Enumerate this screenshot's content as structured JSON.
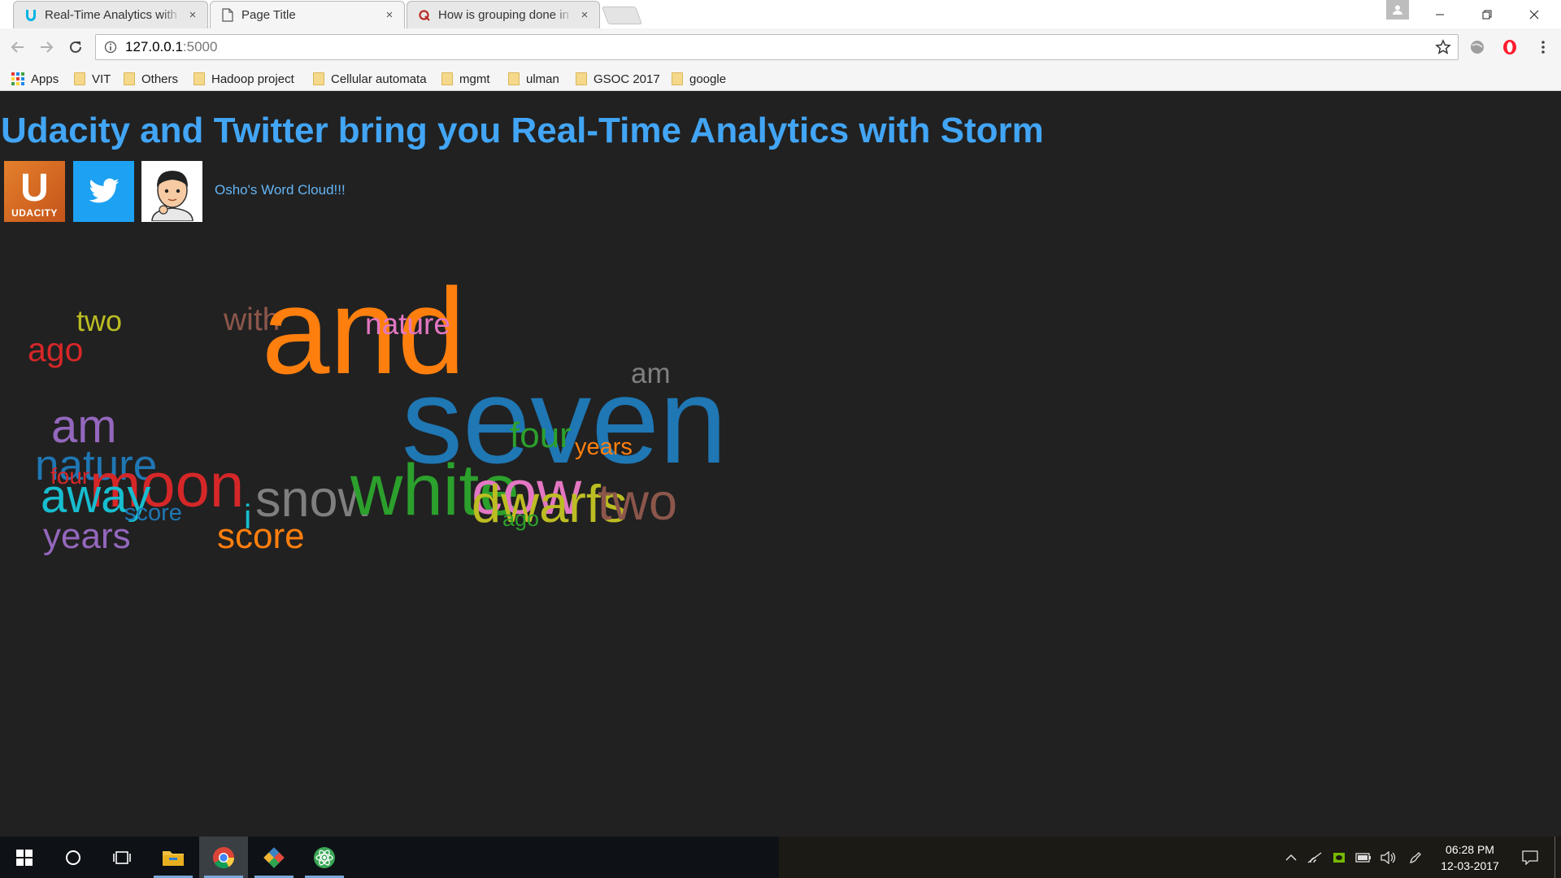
{
  "browser": {
    "tabs": [
      {
        "title": "Real-Time Analytics with",
        "icon": "udacity-icon"
      },
      {
        "title": "Page Title",
        "icon": "page-icon"
      },
      {
        "title": "How is grouping done in",
        "icon": "quora-icon"
      }
    ],
    "close_glyph": "×",
    "url_host": "127.0.0.1",
    "url_port": ":5000",
    "bookmarks": [
      {
        "label": "Apps",
        "icon": "apps-grid-icon"
      },
      {
        "label": "VIT",
        "icon": "folder-icon"
      },
      {
        "label": "Others",
        "icon": "folder-icon"
      },
      {
        "label": "Hadoop project",
        "icon": "folder-icon"
      },
      {
        "label": "Cellular automata",
        "icon": "folder-icon"
      },
      {
        "label": "mgmt",
        "icon": "folder-icon"
      },
      {
        "label": "ulman",
        "icon": "folder-icon"
      },
      {
        "label": "GSOC 2017",
        "icon": "folder-icon"
      },
      {
        "label": "google",
        "icon": "folder-icon"
      }
    ]
  },
  "page": {
    "title": "Udacity and Twitter bring you Real-Time Analytics with Storm",
    "logos": [
      {
        "name": "udacity-logo",
        "text": "U",
        "caption": "UDACITY"
      },
      {
        "name": "twitter-logo"
      },
      {
        "name": "avatar"
      }
    ],
    "cloud_link": "Osho's Word Cloud!!!",
    "word_cloud": {
      "colors": {
        "blue": "#1f77b4",
        "orange": "#ff7f0e",
        "green": "#2ca02c",
        "red": "#d62728",
        "purple": "#9467bd",
        "brown": "#8c564b",
        "pink": "#e377c2",
        "gray": "#7f7f7f",
        "olive": "#bcbd22",
        "cyan": "#17becf"
      },
      "words": [
        {
          "text": "two",
          "color": "olive"
        },
        {
          "text": "ago",
          "color": "red"
        },
        {
          "text": "with",
          "color": "brown"
        },
        {
          "text": "and",
          "color": "orange"
        },
        {
          "text": "nature",
          "color": "pink"
        },
        {
          "text": "am",
          "color": "gray"
        },
        {
          "text": "am",
          "color": "purple"
        },
        {
          "text": "seven",
          "color": "blue"
        },
        {
          "text": "four",
          "color": "green"
        },
        {
          "text": "years",
          "color": "orange"
        },
        {
          "text": "nature",
          "color": "blue"
        },
        {
          "text": "four",
          "color": "red"
        },
        {
          "text": "moon",
          "color": "red"
        },
        {
          "text": "away",
          "color": "cyan"
        },
        {
          "text": "score",
          "color": "blue"
        },
        {
          "text": "snow",
          "color": "gray"
        },
        {
          "text": "white",
          "color": "green"
        },
        {
          "text": "cow",
          "color": "pink"
        },
        {
          "text": "dwarfs",
          "color": "olive"
        },
        {
          "text": "two",
          "color": "brown"
        },
        {
          "text": "ago",
          "color": "green"
        },
        {
          "text": "i",
          "color": "cyan"
        },
        {
          "text": "years",
          "color": "purple"
        },
        {
          "text": "score",
          "color": "orange"
        }
      ]
    }
  },
  "taskbar": {
    "items": [
      {
        "name": "start-button",
        "icon": "windows-icon"
      },
      {
        "name": "cortana-button",
        "icon": "circle-icon"
      },
      {
        "name": "task-view-button",
        "icon": "task-view-icon"
      },
      {
        "name": "file-explorer-taskbar",
        "icon": "folder-icon"
      },
      {
        "name": "chrome-taskbar",
        "icon": "chrome-icon"
      },
      {
        "name": "git-taskbar",
        "icon": "git-icon"
      },
      {
        "name": "atom-taskbar",
        "icon": "atom-icon"
      }
    ],
    "clock_time": "06:28 PM",
    "clock_date": "12-03-2017"
  }
}
